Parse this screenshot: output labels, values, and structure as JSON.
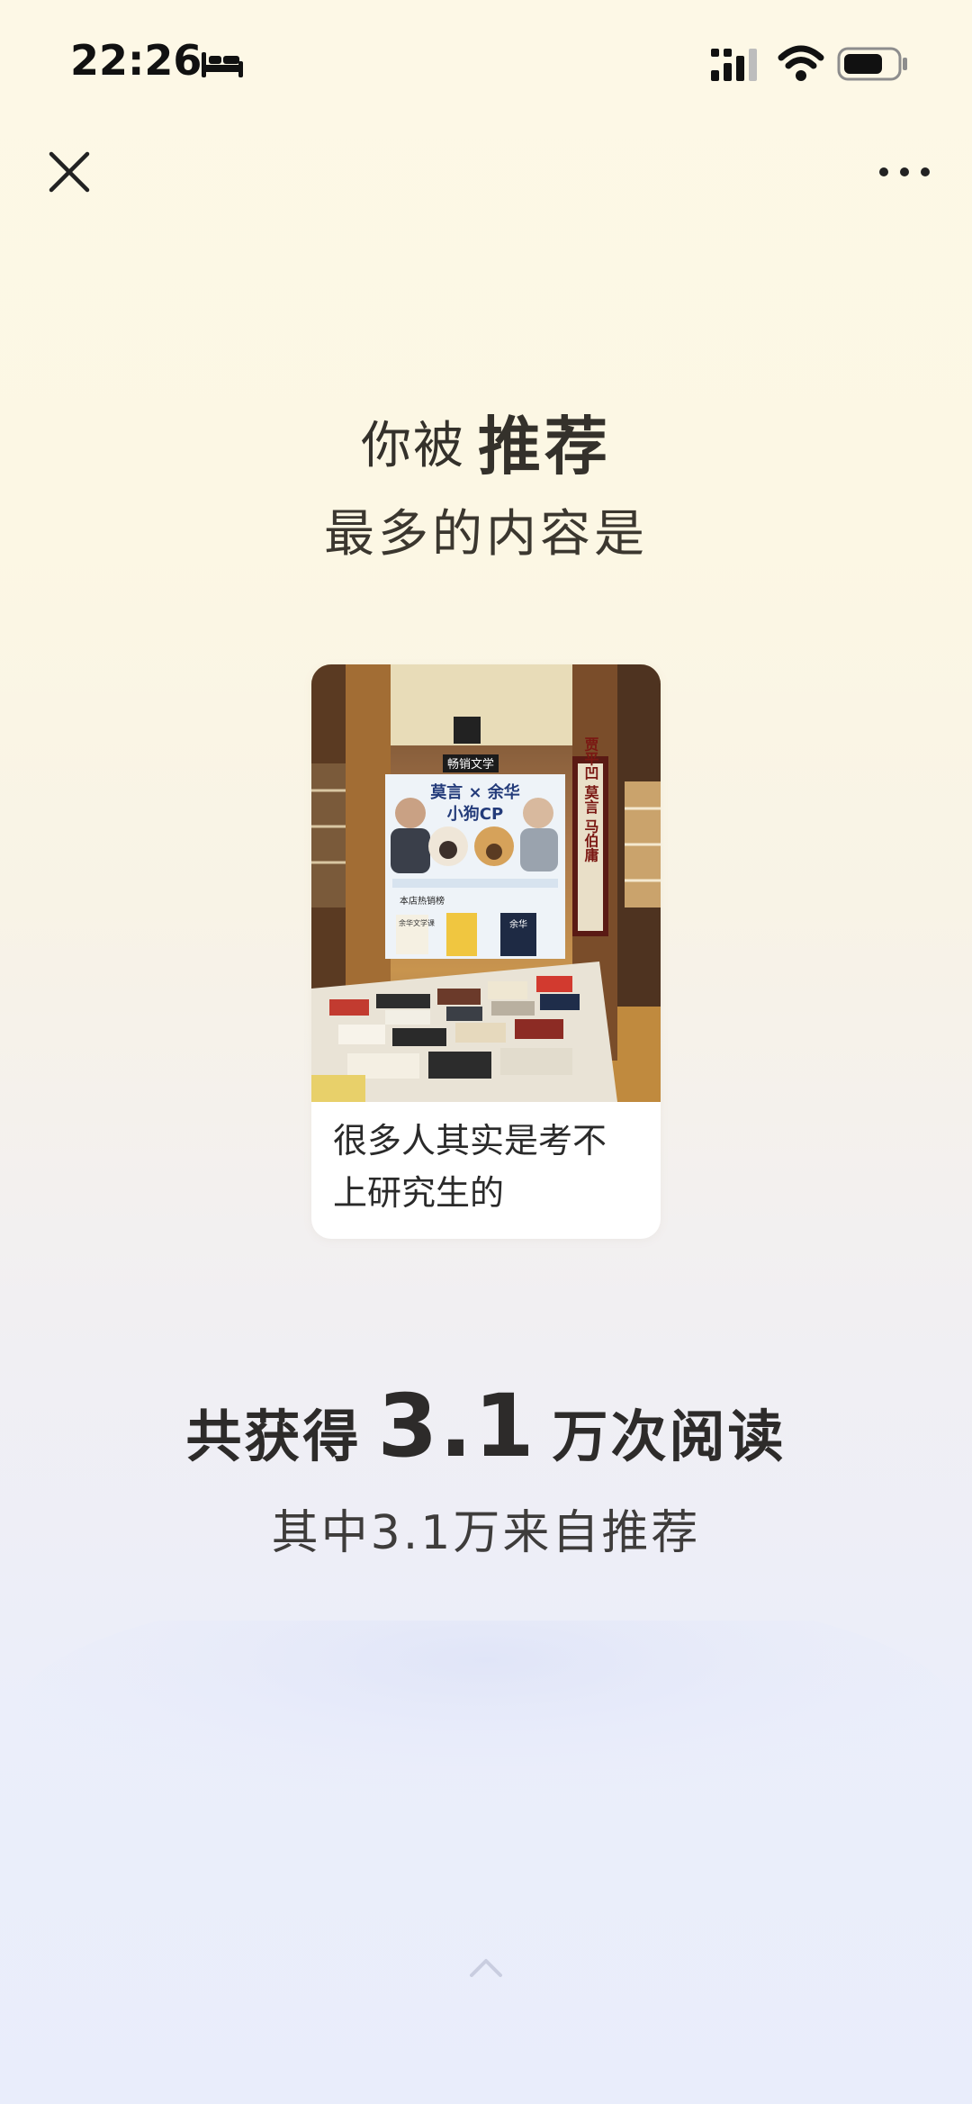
{
  "status_bar": {
    "time": "22:26",
    "icons": [
      "bed-icon",
      "signal-icon",
      "wifi-icon",
      "battery-icon"
    ]
  },
  "top_bar": {
    "left_icon": "close-icon",
    "right_icon": "more-icon"
  },
  "headline": {
    "prefix": "你被",
    "emphasis": "推荐",
    "line2": "最多的内容是"
  },
  "card": {
    "caption": "很多人其实是考不上研究生的",
    "image_texts": {
      "store_sign": "畅销文学",
      "poster_title": "莫言 × 余华",
      "poster_subtitle": "小狗CP",
      "poster_section": "本店热销榜",
      "book_label_1": "余华文学课",
      "book_label_2": "余华",
      "pillar_sign": "贾平凹 莫言 马伯庸"
    }
  },
  "stats": {
    "prefix": "共获得",
    "number": "3.1",
    "suffix": "万次阅读",
    "sub": "其中3.1万来自推荐"
  },
  "colors": {
    "bg_top": "#fdf8e6",
    "bg_bottom": "#e9edfb",
    "text": "#2f2a22"
  },
  "bottom": {
    "icon": "chevron-up-icon"
  }
}
